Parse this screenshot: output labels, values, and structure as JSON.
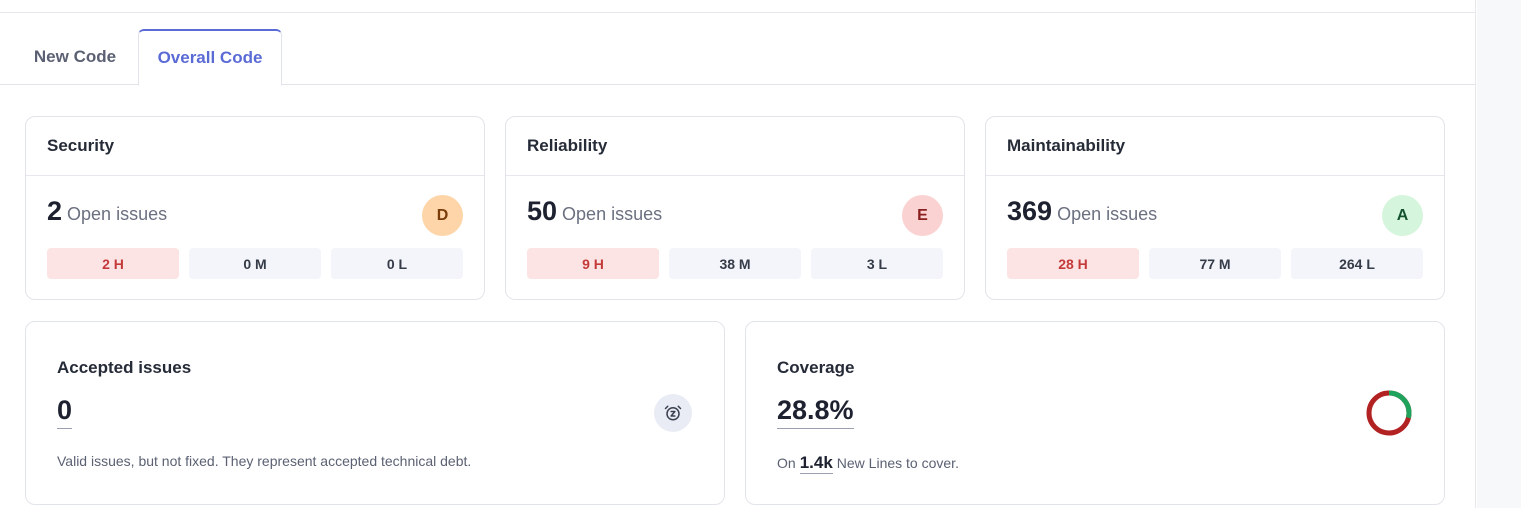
{
  "tabs": [
    {
      "label": "New Code"
    },
    {
      "label": "Overall Code"
    }
  ],
  "metrics": [
    {
      "title": "Security",
      "count": "2",
      "count_label": "Open issues",
      "grade": "D",
      "grade_bg": "#fdd5a8",
      "grade_fg": "#7a3d0a",
      "severities": [
        "2 H",
        "0 M",
        "0 L"
      ]
    },
    {
      "title": "Reliability",
      "count": "50",
      "count_label": "Open issues",
      "grade": "E",
      "grade_bg": "#fbd2d2",
      "grade_fg": "#8a1f1f",
      "severities": [
        "9 H",
        "38 M",
        "3 L"
      ]
    },
    {
      "title": "Maintainability",
      "count": "369",
      "count_label": "Open issues",
      "grade": "A",
      "grade_bg": "#d6f5dd",
      "grade_fg": "#14532d",
      "severities": [
        "28 H",
        "77 M",
        "264 L"
      ]
    }
  ],
  "accepted": {
    "title": "Accepted issues",
    "value": "0",
    "description": "Valid issues, but not fixed. They represent accepted technical debt.",
    "icon": "snooze-icon"
  },
  "coverage": {
    "title": "Coverage",
    "value": "28.8%",
    "percent": 28.8,
    "desc_prefix": "On",
    "desc_value": "1.4k",
    "desc_suffix": "New Lines to cover.",
    "covered_color": "#1fa25b",
    "uncovered_color": "#b32222"
  }
}
